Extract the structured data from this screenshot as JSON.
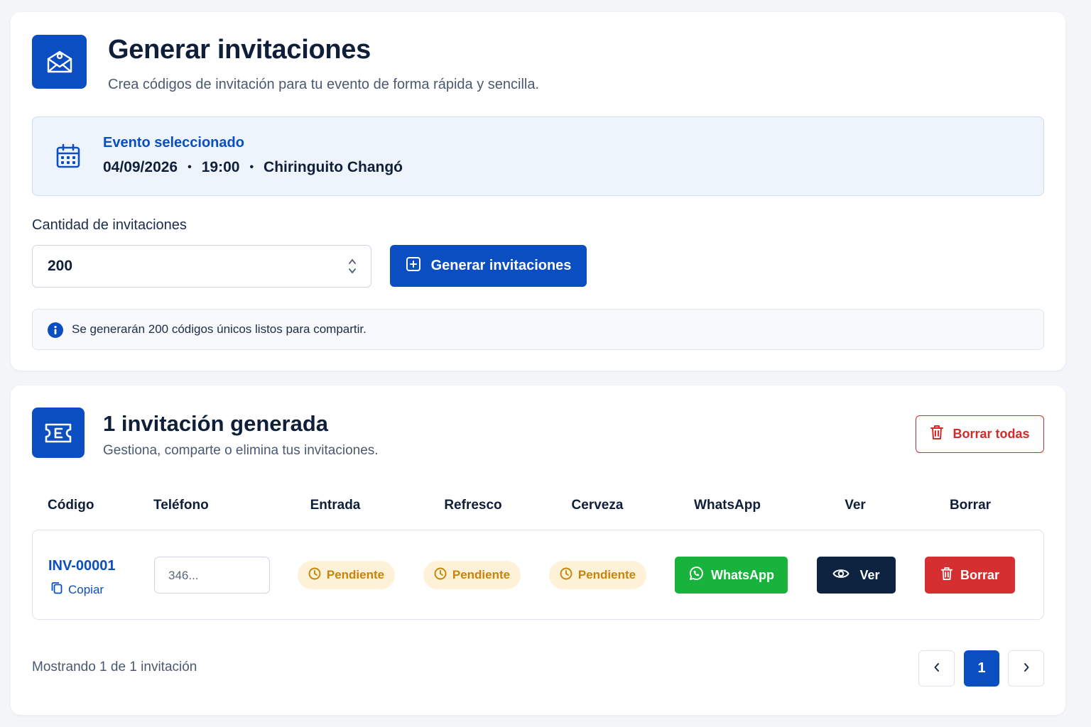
{
  "generator": {
    "title": "Generar invitaciones",
    "subtitle": "Crea códigos de invitación para tu evento de forma rápida y sencilla.",
    "header_icon": "envelope-icon",
    "event": {
      "label": "Evento seleccionado",
      "date": "04/09/2026",
      "time": "19:00",
      "venue": "Chiringuito Changó",
      "separator": "•",
      "icon": "calendar-icon"
    },
    "quantity": {
      "label": "Cantidad de invitaciones",
      "value": "200"
    },
    "generate_button": "Generar invitaciones",
    "info_text": "Se generarán 200 códigos únicos listos para compartir."
  },
  "invitations": {
    "title": "1 invitación generada",
    "subtitle": "Gestiona, comparte o elimina tus invitaciones.",
    "header_icon": "ticket-icon",
    "delete_all_button": "Borrar todas",
    "columns": [
      "Código",
      "Teléfono",
      "Entrada",
      "Refresco",
      "Cerveza",
      "WhatsApp",
      "Ver",
      "Borrar"
    ],
    "rows": [
      {
        "code": "INV-00001",
        "copy_label": "Copiar",
        "phone": "346...",
        "entrada": "Pendiente",
        "refresco": "Pendiente",
        "cerveza": "Pendiente",
        "whatsapp_label": "WhatsApp",
        "view_label": "Ver",
        "delete_label": "Borrar"
      }
    ],
    "footer_text": "Mostrando 1 de 1 invitación",
    "pagination": {
      "prev": "‹",
      "current": "1",
      "next": "›"
    }
  },
  "colors": {
    "primary": "#0b4ec2",
    "danger": "#d62f31",
    "whatsapp": "#18b33c",
    "dark": "#0d2340",
    "pending": "#c98307",
    "pending_bg": "#fdf2d7"
  }
}
